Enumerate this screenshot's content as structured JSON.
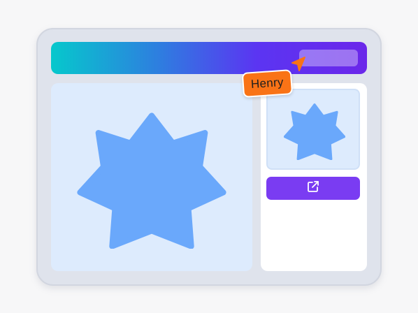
{
  "colors": {
    "window_bg": "#dfe3ec",
    "gradient_start": "#06c8cc",
    "gradient_end": "#6b27ea",
    "panel_bg": "#ddebfd",
    "star": "#6aa8fb",
    "button": "#7a3cf2",
    "cursor": "#f97316"
  },
  "main": {
    "image_icon": "seven-point-star-icon"
  },
  "sidebar": {
    "thumbnail_icon": "seven-point-star-icon",
    "open_button_icon": "external-link-icon"
  },
  "collaborator": {
    "name": "Henry",
    "cursor_icon": "pointer-cursor-icon"
  }
}
